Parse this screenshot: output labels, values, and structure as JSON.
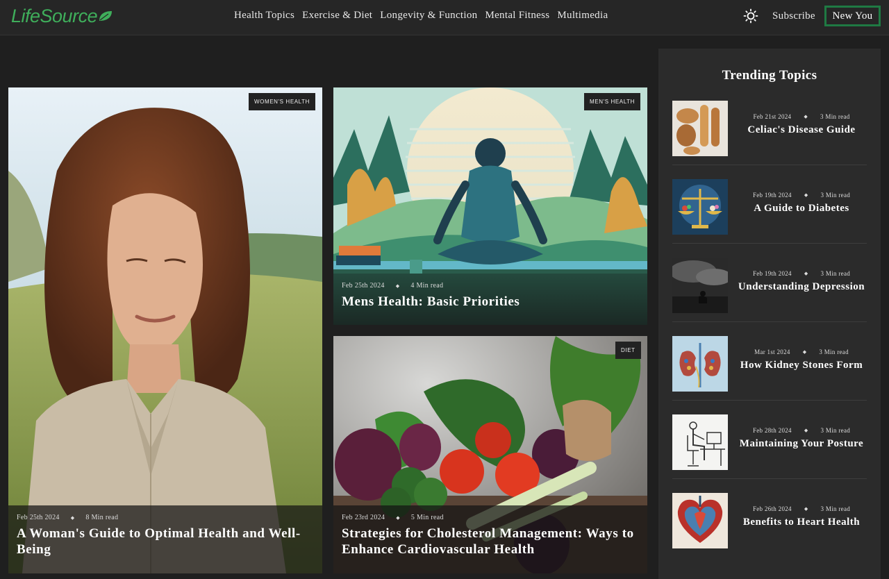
{
  "header": {
    "logo_text": "LifeSource",
    "nav": [
      "Health Topics",
      "Exercise & Diet",
      "Longevity & Function",
      "Mental Fitness",
      "Multimedia"
    ],
    "subscribe_label": "Subscribe",
    "cta_label": "New You",
    "brand_color": "#3fae5b",
    "theme_icon": "sun-icon"
  },
  "features": [
    {
      "tag": "WOMEN'S HEALTH",
      "date": "Feb 25th 2024",
      "read": "8 Min read",
      "title": "A Woman's Guide to Optimal Health and Well-Being",
      "image": "woman-portrait-field"
    },
    {
      "tag": "MEN'S HEALTH",
      "date": "Feb 25th 2024",
      "read": "4 Min read",
      "title": "Mens Health: Basic Priorities",
      "image": "man-meditating-lake"
    },
    {
      "tag": "DIET",
      "date": "Feb 23rd 2024",
      "read": "5 Min read",
      "title": "Strategies for Cholesterol Management: Ways to Enhance Cardiovascular Health",
      "image": "vegetables-still-life"
    }
  ],
  "sidebar": {
    "heading": "Trending Topics",
    "items": [
      {
        "date": "Feb 21st 2024",
        "read": "3 Min read",
        "title": "Celiac's Disease Guide",
        "image": "bread-loaves"
      },
      {
        "date": "Feb 19th 2024",
        "read": "3 Min read",
        "title": "A Guide to Diabetes",
        "image": "balance-scale"
      },
      {
        "date": "Feb 19th 2024",
        "read": "3 Min read",
        "title": "Understanding Depression",
        "image": "stormy-figure"
      },
      {
        "date": "Mar 1st 2024",
        "read": "3 Min read",
        "title": "How Kidney Stones Form",
        "image": "kidneys"
      },
      {
        "date": "Feb 28th 2024",
        "read": "3 Min read",
        "title": "Maintaining Your Posture",
        "image": "desk-posture-sketch"
      },
      {
        "date": "Feb 26th 2024",
        "read": "3 Min read",
        "title": "Benefits to Heart Health",
        "image": "anatomical-heart"
      }
    ]
  }
}
